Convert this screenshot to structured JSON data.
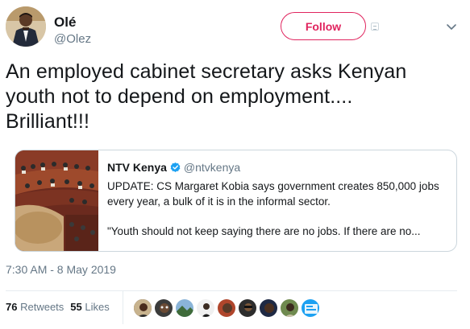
{
  "author": {
    "name": "Olé",
    "handle": "@Olez"
  },
  "follow_label": "Follow",
  "tweet": {
    "lines": [
      "An employed cabinet secretary asks Kenyan",
      "youth not to depend on employment....",
      "Brilliant!!!"
    ]
  },
  "quoted": {
    "name": "NTV Kenya",
    "handle": "@ntvkenya",
    "lines": [
      "UPDATE: CS Margaret Kobia says government creates 850,000 jobs",
      "every year, a bulk of it is in the informal sector.",
      "\"Youth should not keep saying there are no jobs. If there are no..."
    ]
  },
  "timestamp": "7:30 AM - 8 May 2019",
  "stats": {
    "retweets_count": "76",
    "retweets_label": "Retweets",
    "likes_count": "55",
    "likes_label": "Likes"
  },
  "colors": {
    "follow": "#e0245e",
    "verified": "#1da1f2",
    "muted": "#657786",
    "border": "#ccd6dd"
  },
  "icons": {
    "caret": "chevron-down-icon",
    "verified": "verified-badge-icon"
  }
}
